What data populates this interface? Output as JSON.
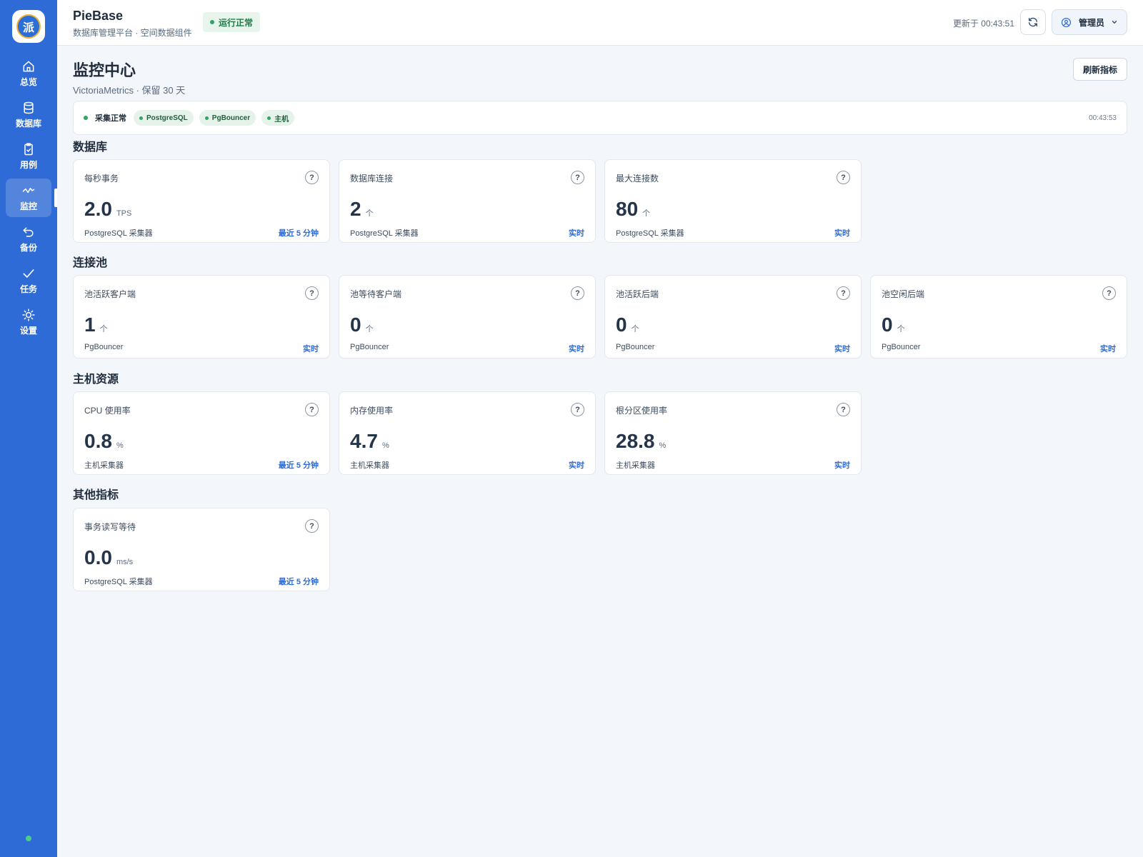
{
  "app": {
    "logo_text": "派",
    "title": "PieBase",
    "subtitle": "数据库管理平台 · 空间数据组件",
    "status_badge": "运行正常",
    "updated": "更新于 00:43:51",
    "user": "管理员"
  },
  "nav": {
    "items": [
      {
        "label": "总览",
        "icon": "home-icon"
      },
      {
        "label": "数据库",
        "icon": "database-icon"
      },
      {
        "label": "用例",
        "icon": "clipboard-check-icon"
      },
      {
        "label": "监控",
        "icon": "activity-icon",
        "active": true
      },
      {
        "label": "备份",
        "icon": "undo-icon"
      },
      {
        "label": "任务",
        "icon": "check-icon"
      },
      {
        "label": "设置",
        "icon": "sun-settings-icon"
      }
    ]
  },
  "page": {
    "title": "监控中心",
    "subtitle": "VictoriaMetrics · 保留 30 天",
    "refresh_button": "刷新指标"
  },
  "status_bar": {
    "collect_label": "采集正常",
    "chips": [
      "PostgreSQL",
      "PgBouncer",
      "主机"
    ],
    "time": "00:43:53"
  },
  "sections": [
    {
      "title": "数据库",
      "cards": [
        {
          "title": "每秒事务",
          "value": "2.0",
          "unit": "TPS",
          "source": "PostgreSQL 采集器",
          "window": "最近 5 分钟"
        },
        {
          "title": "数据库连接",
          "value": "2",
          "unit": "个",
          "source": "PostgreSQL 采集器",
          "window": "实时"
        },
        {
          "title": "最大连接数",
          "value": "80",
          "unit": "个",
          "source": "PostgreSQL 采集器",
          "window": "实时"
        }
      ]
    },
    {
      "title": "连接池",
      "cards": [
        {
          "title": "池活跃客户端",
          "value": "1",
          "unit": "个",
          "source": "PgBouncer",
          "window": "实时"
        },
        {
          "title": "池等待客户端",
          "value": "0",
          "unit": "个",
          "source": "PgBouncer",
          "window": "实时"
        },
        {
          "title": "池活跃后端",
          "value": "0",
          "unit": "个",
          "source": "PgBouncer",
          "window": "实时"
        },
        {
          "title": "池空闲后端",
          "value": "0",
          "unit": "个",
          "source": "PgBouncer",
          "window": "实时"
        }
      ]
    },
    {
      "title": "主机资源",
      "cards": [
        {
          "title": "CPU 使用率",
          "value": "0.8",
          "unit": "%",
          "source": "主机采集器",
          "window": "最近 5 分钟"
        },
        {
          "title": "内存使用率",
          "value": "4.7",
          "unit": "%",
          "source": "主机采集器",
          "window": "实时"
        },
        {
          "title": "根分区使用率",
          "value": "28.8",
          "unit": "%",
          "source": "主机采集器",
          "window": "实时"
        }
      ]
    },
    {
      "title": "其他指标",
      "cards": [
        {
          "title": "事务读写等待",
          "value": "0.0",
          "unit": "ms/s",
          "source": "PostgreSQL 采集器",
          "window": "最近 5 分钟"
        }
      ]
    }
  ],
  "colors": {
    "sidebar": "#2e6bd6",
    "accent": "#2e6bd6",
    "ok_green": "#2fa561",
    "background": "#f3f6fa"
  }
}
